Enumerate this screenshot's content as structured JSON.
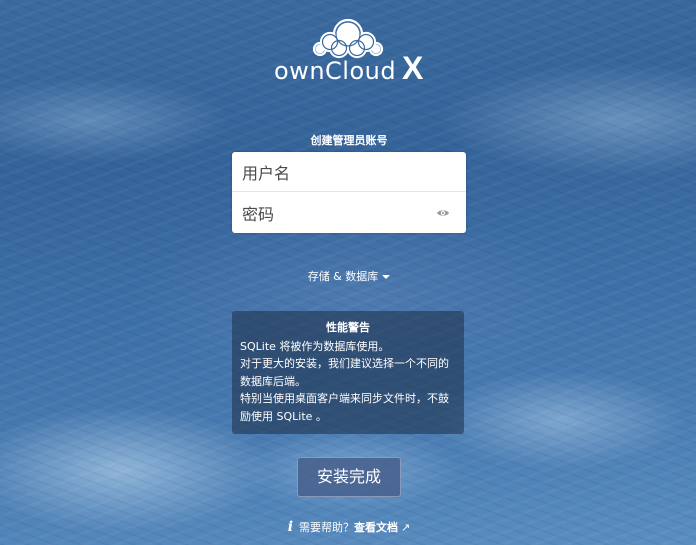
{
  "logo": {
    "text": "ownCloud",
    "suffix": "X"
  },
  "form": {
    "title": "创建管理员账号",
    "username_placeholder": "用户名",
    "password_placeholder": "密码"
  },
  "storage": {
    "label": "存储 & 数据库"
  },
  "warning": {
    "title": "性能警告",
    "line1": "SQLite 将被作为数据库使用。",
    "line2": "对于更大的安装，我们建议选择一个不同的数据库后端。",
    "line3": "特别当使用桌面客户端来同步文件时，不鼓励使用 SQLite 。"
  },
  "install_button": {
    "label": "安装完成"
  },
  "help": {
    "prefix": "需要帮助？",
    "link": "查看文档",
    "arrow": "↗"
  },
  "icons": {
    "help": "info-icon",
    "eye": "eye-icon",
    "logo": "cloud-icon",
    "caret": "caret-down-icon",
    "external": "external-link-icon"
  }
}
